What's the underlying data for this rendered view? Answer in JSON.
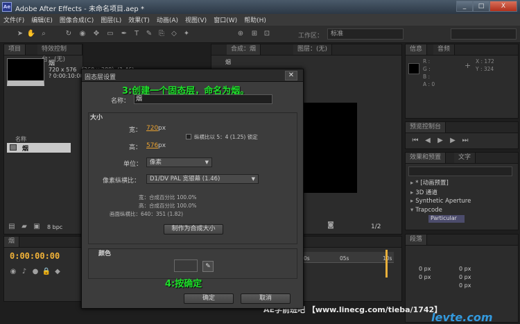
{
  "window": {
    "logo": "Ae",
    "title": "Adobe After Effects - 未命名项目.aep *",
    "minimize": "_",
    "maximize": "□",
    "close": "X"
  },
  "menu": [
    "文件(F)",
    "编辑(E)",
    "图像合成(C)",
    "图层(L)",
    "效果(T)",
    "动画(A)",
    "视图(V)",
    "窗口(W)",
    "帮助(H)"
  ],
  "toolbar": {
    "workspace_label": "工作区：",
    "workspace_value": "标准"
  },
  "project_panel": {
    "tab_project": "项目",
    "tab_effect_controls": "特效控制台：(无)",
    "item_name": "烟",
    "item_info_1": "720 x 576 （360 x 288）(1.46)",
    "item_info_2": "? 0:00:10:00",
    "col_name": "名称",
    "layer_name": "烟",
    "bpc": "8 bpc"
  },
  "comp_panel": {
    "tab_comp": "合成：烟",
    "tab_layer": "图层：(无)",
    "comp_label": "烟",
    "zoom": "1/2"
  },
  "info_panel": {
    "tab_info": "信息",
    "tab_audio": "音频",
    "r": "R :",
    "g": "G :",
    "b": "B :",
    "a": "A : 0",
    "x": "X : 172",
    "y": "Y : 324"
  },
  "preview_panel": {
    "tab": "预览控制台"
  },
  "effects_panel": {
    "tab_effects": "效果和预置",
    "tab_text": "文字",
    "items": [
      "* [动画预置]",
      "3D 通道",
      "Synthetic Aperture",
      "Trapcode"
    ],
    "highlight": "Particular"
  },
  "paragraph_panel": {
    "tab": "段落",
    "values": [
      "0 px",
      "0 px",
      "0 px",
      "0 px",
      "0 px"
    ]
  },
  "timeline": {
    "tab": "烟",
    "timecode": "0:00:00:00",
    "ticks": [
      "0s",
      "05s",
      "10s"
    ]
  },
  "dialog": {
    "title": "固态层设置",
    "close": "✕",
    "annotation_top": "3:创建一个固态层，命名为烟。",
    "annotation_bottom": "4:按确定",
    "name_label": "名称：",
    "name_value": "烟",
    "size_title": "大小",
    "width_label": "宽：",
    "width_value": "720",
    "width_unit": "px",
    "height_label": "高：",
    "height_value": "576",
    "height_unit": "px",
    "lock_label": "纵横比以 5：4 (1.25) 锁定",
    "units_label": "单位：",
    "units_value": "像素",
    "par_label": "像素纵横比：",
    "par_value": "D1/DV PAL 宽银幕 (1.46)",
    "info_w": "宽：合成百分比 100.0%",
    "info_h": "高：合成百分比 100.0%",
    "info_frame": "画面纵横比：640：351 (1.82)",
    "make_comp_size": "制作为合成大小",
    "color_title": "颜色",
    "ok": "确定",
    "cancel": "取消"
  },
  "footer": {
    "text": "AE学前班吧 【www.linecg.com/tieba/1742】",
    "watermark": "levte.com"
  }
}
